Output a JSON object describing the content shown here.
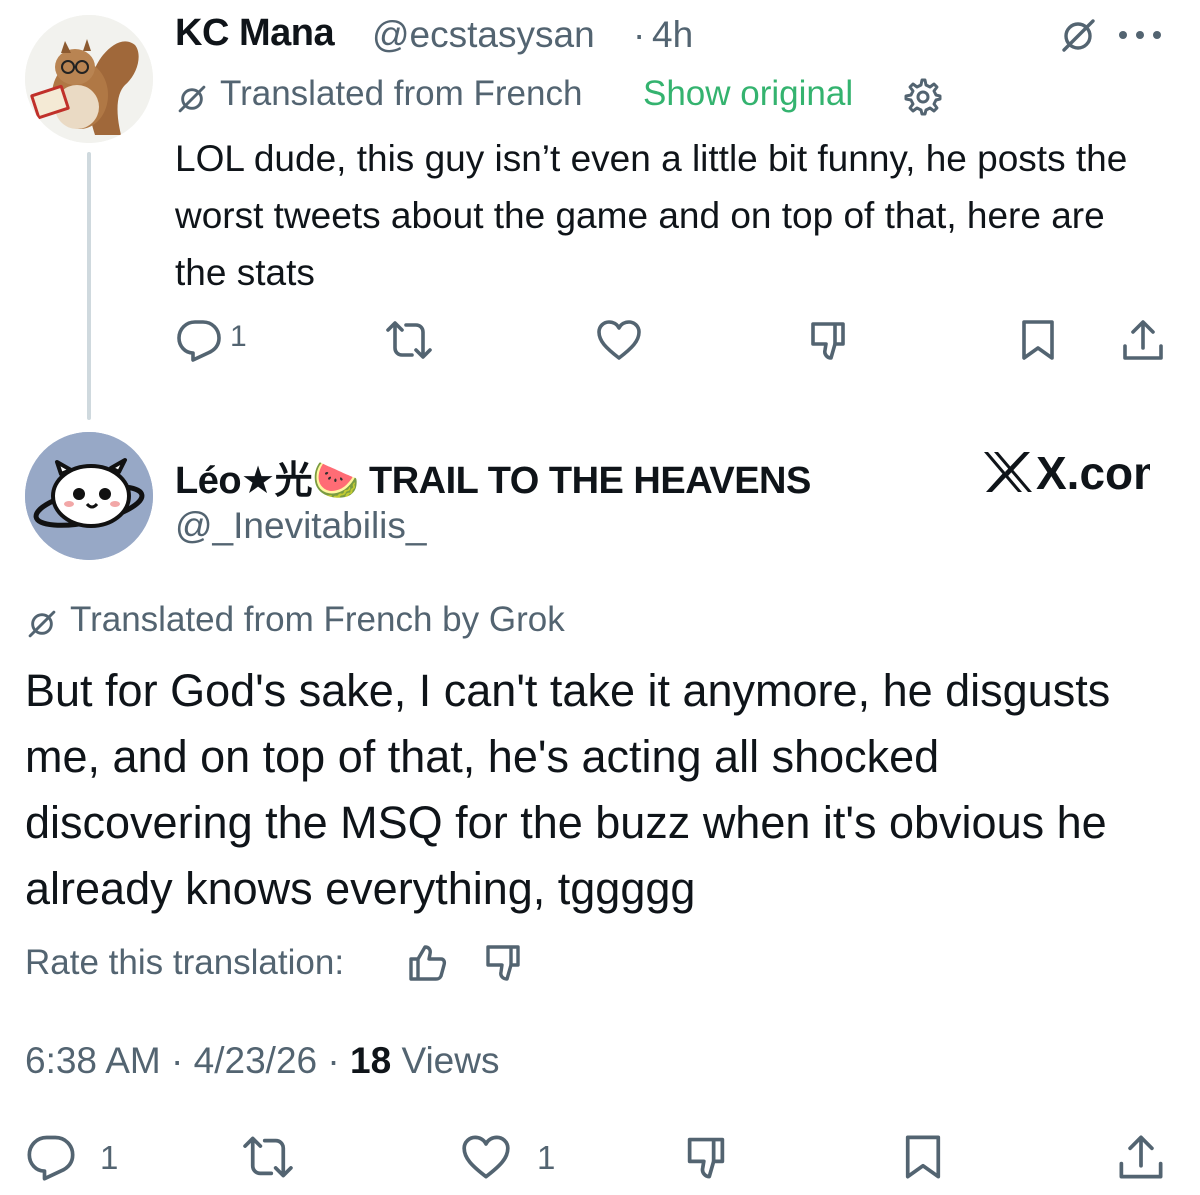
{
  "reply_tweet": {
    "author_name": "KC Mana",
    "handle": "@ecstasysan",
    "separator": "·",
    "time": "4h",
    "translation_label": "Translated from French",
    "show_original": "Show original",
    "body": "LOL dude, this guy isn’t even a little bit funny, he posts the worst tweets about the game and on top of that, here are the stats",
    "reply_count": "1",
    "icons": [
      "grok-icon",
      "more-icon",
      "translate-icon",
      "gear-icon",
      "reply-icon",
      "retweet-icon",
      "like-icon",
      "grok-icon",
      "bookmark-icon",
      "share-icon"
    ],
    "accent_color": "#34b36f"
  },
  "main_tweet": {
    "author_name": "Léo★光🍉 TRAIL TO THE HEAVENS",
    "handle": "@_Inevitabilis_",
    "watermark": "X.com",
    "translation_label": "Translated from French by Grok",
    "body": "But for God's sake, I can't take it anymore, he disgusts me, and on top of that, he's acting all shocked discovering the MSQ for the buzz when it's obvious he already knows everything, tggggg",
    "rate_label": "Rate this translation:",
    "time": "6:38 AM",
    "date": "4/23/26",
    "views_count": "18",
    "views_label": "Views",
    "reply_count": "1",
    "like_count": "1",
    "icons": [
      "translate-icon",
      "thumbs-up-icon",
      "thumbs-down-icon",
      "reply-icon",
      "retweet-icon",
      "like-icon",
      "grok-icon",
      "bookmark-icon",
      "share-icon"
    ]
  },
  "colors": {
    "text": "#0f1419",
    "secondary": "#536471",
    "thread_line": "#cfd9de"
  }
}
